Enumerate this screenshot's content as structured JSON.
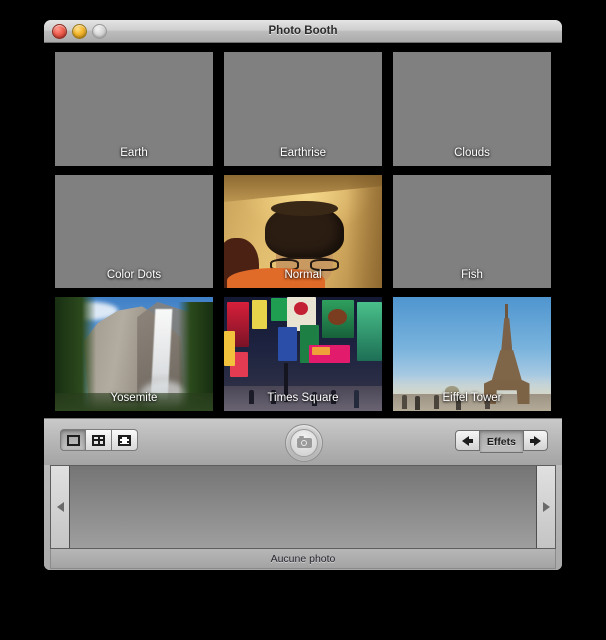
{
  "window": {
    "title": "Photo Booth",
    "controls": [
      {
        "name": "close",
        "color": "#ef5f50"
      },
      {
        "name": "minimize",
        "color": "#f4b528"
      },
      {
        "name": "zoom",
        "color": "#d8d8d8"
      }
    ]
  },
  "effects": {
    "tiles": [
      {
        "label": "Earth",
        "kind": "placeholder",
        "selected": false
      },
      {
        "label": "Earthrise",
        "kind": "placeholder",
        "selected": false
      },
      {
        "label": "Clouds",
        "kind": "placeholder",
        "selected": false
      },
      {
        "label": "Color Dots",
        "kind": "placeholder",
        "selected": false
      },
      {
        "label": "Normal",
        "kind": "camera",
        "selected": true
      },
      {
        "label": "Fish",
        "kind": "placeholder",
        "selected": false
      },
      {
        "label": "Yosemite",
        "kind": "yosemite",
        "selected": false
      },
      {
        "label": "Times Square",
        "kind": "times-square",
        "selected": false
      },
      {
        "label": "Eiffel Tower",
        "kind": "eiffel",
        "selected": false
      }
    ]
  },
  "toolbar": {
    "modes": [
      {
        "name": "single-photo",
        "icon": "single-frame-icon",
        "selected": true
      },
      {
        "name": "four-up",
        "icon": "grid-icon",
        "selected": false
      },
      {
        "name": "movie",
        "icon": "filmstrip-icon",
        "selected": false
      }
    ],
    "shutter": {
      "icon": "camera-icon",
      "enabled": false
    },
    "effects_prev": "◀",
    "effects_label": "Effets",
    "effects_next": "▶"
  },
  "tray": {
    "scroll_left": "◀",
    "scroll_right": "▶",
    "status": "Aucune photo"
  },
  "colors": {
    "desktop": "#000000",
    "placeholder_tile": "#808080",
    "window_chrome": "#b4b4b4"
  }
}
